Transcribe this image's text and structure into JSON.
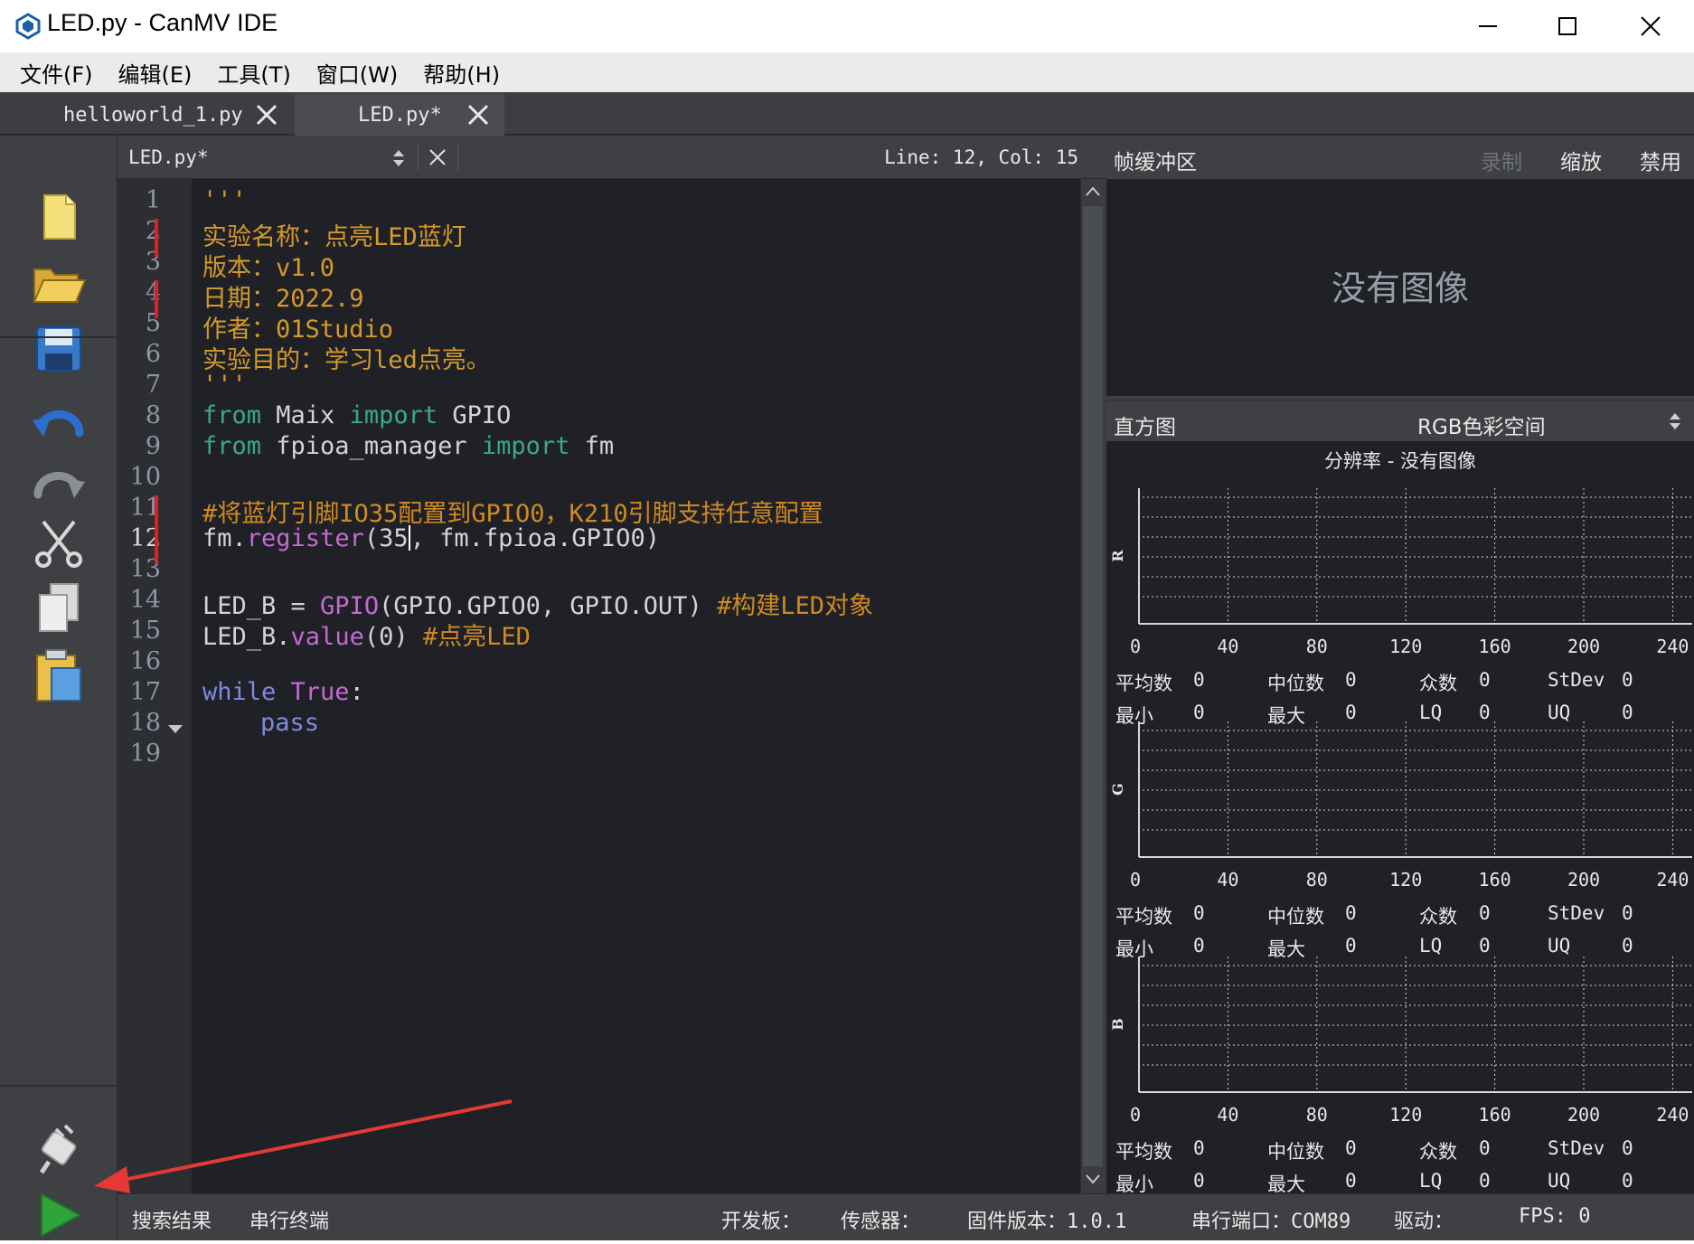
{
  "window": {
    "title": "LED.py - CanMV IDE",
    "controls": [
      "minimize-icon",
      "maximize-icon",
      "close-icon"
    ]
  },
  "menu": [
    "文件(F)",
    "编辑(E)",
    "工具(T)",
    "窗口(W)",
    "帮助(H)"
  ],
  "tabs": [
    {
      "label": "helloworld_1.py",
      "active": false
    },
    {
      "label": "LED.py*",
      "active": true
    }
  ],
  "editor": {
    "file_label": "LED.py*",
    "position": "Line: 12, Col: 15",
    "current_line": "12",
    "line_numbers": [
      "1",
      "2",
      "3",
      "4",
      "5",
      "6",
      "7",
      "8",
      "9",
      "10",
      "11",
      "12",
      "13",
      "14",
      "15",
      "16",
      "17",
      "18",
      "19"
    ]
  },
  "code": {
    "l1": "'''",
    "l2": "实验名称：点亮LED蓝灯",
    "l3": "版本：v1.0",
    "l4": "日期：2022.9",
    "l5": "作者：01Studio",
    "l6": "实验目的：学习led点亮。",
    "l7": "'''",
    "l8_kw1": "from",
    "l8_mod": " Maix ",
    "l8_kw2": "import",
    "l8_name": " GPIO",
    "l9_kw1": "from",
    "l9_mod": " fpioa_manager ",
    "l9_kw2": "import",
    "l9_name": " fm",
    "l11": "#将蓝灯引脚IO35配置到GPIO0，K210引脚支持任意配置",
    "l12_a": "fm.",
    "l12_fn": "register",
    "l12_b": "(35",
    "l12_c": ", fm.fpioa.GPIO0)",
    "l14_a": "LED_B = ",
    "l14_fn": "GPIO",
    "l14_b": "(GPIO.GPIO0, GPIO.OUT) ",
    "l14_cm": "#构建LED对象",
    "l15_a": "LED_B.",
    "l15_fn": "value",
    "l15_b": "(0) ",
    "l15_cm": "#点亮LED",
    "l17_kw": "while",
    "l17_val": " True",
    "l17_colon": ":",
    "l18": "pass"
  },
  "framebuffer": {
    "title": "帧缓冲区",
    "record": "录制",
    "zoom": "缩放",
    "disable": "禁用",
    "no_image": "没有图像"
  },
  "histogram": {
    "title": "直方图",
    "colorspace": "RGB色彩空间",
    "resolution": "分辨率 - 没有图像",
    "channels": [
      "R",
      "G",
      "B"
    ],
    "x_ticks": [
      "0",
      "40",
      "80",
      "120",
      "160",
      "200",
      "240"
    ],
    "stats": {
      "mean_label": "平均数",
      "mean": "0",
      "median_label": "中位数",
      "median": "0",
      "mode_label": "众数",
      "mode": "0",
      "stdev_label": "StDev",
      "stdev": "0",
      "min_label": "最小",
      "min": "0",
      "max_label": "最大",
      "max": "0",
      "lq_label": "LQ",
      "lq": "0",
      "uq_label": "UQ",
      "uq": "0"
    }
  },
  "toolbar_icons": [
    "new-file-icon",
    "open-folder-icon",
    "save-icon",
    "undo-icon",
    "redo-icon",
    "cut-icon",
    "copy-icon",
    "paste-icon",
    "connect-plug-icon",
    "run-play-icon"
  ],
  "status": {
    "search_results": "搜索结果",
    "serial_terminal": "串行终端",
    "board": "开发板：",
    "sensor": "传感器：",
    "firmware": "固件版本：1.0.1",
    "serial_port": "串行端口：COM89",
    "driver": "驱动：",
    "fps": "FPS: 0"
  },
  "colors": {
    "accent_arrow": "#e53935",
    "play_green": "#2fa43a"
  }
}
